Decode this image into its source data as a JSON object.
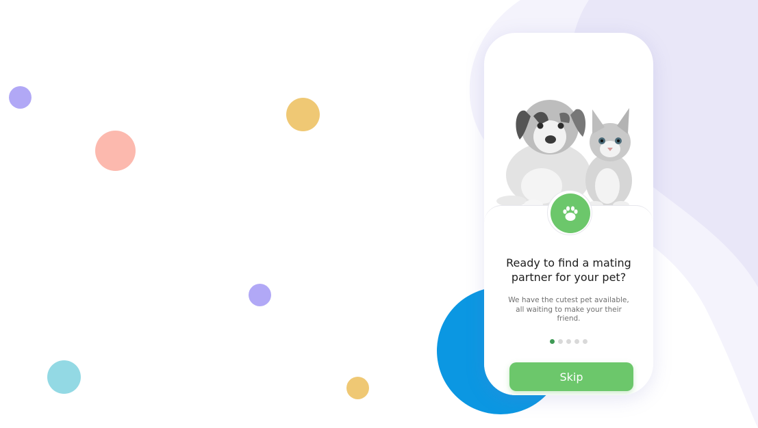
{
  "onboarding": {
    "title": "Ready to find a mating partner for your pet?",
    "description": "We have the cutest pet available, all waiting to make your their friend.",
    "page_count": 5,
    "current_page": 1,
    "skip_label": "Skip"
  },
  "icons": {
    "badge": "paw-icon"
  },
  "colors": {
    "accent_green": "#6cc76b",
    "active_dot": "#3f9a55",
    "blue_circle": "#0b97e2",
    "lavender": "#eceaf8"
  }
}
